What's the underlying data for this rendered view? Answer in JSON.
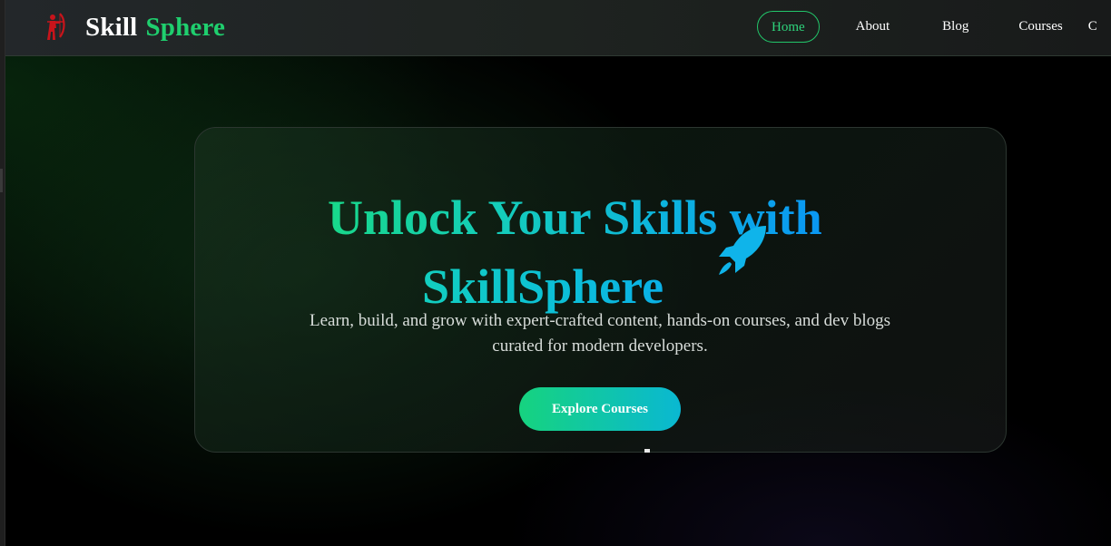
{
  "brand": {
    "first": "Skill",
    "second": "Sphere",
    "logo_icon": "archer-icon",
    "accent_color": "#1fcf6e",
    "logo_color": "#c8141b"
  },
  "nav": {
    "items": [
      {
        "label": "Home",
        "active": true
      },
      {
        "label": "About"
      },
      {
        "label": "Blog"
      },
      {
        "label": "Courses"
      },
      {
        "label": "C"
      }
    ]
  },
  "hero": {
    "title_line1": "Unlock Your Skills with",
    "title_line2": "SkillSphere",
    "title_icon": "rocket-icon",
    "subtitle": "Learn, build, and grow with expert-crafted content, hands-on courses, and dev blogs curated for modern developers.",
    "cta_label": "Explore Courses",
    "gradient_start": "#18d88a",
    "gradient_end": "#0a97f3"
  }
}
